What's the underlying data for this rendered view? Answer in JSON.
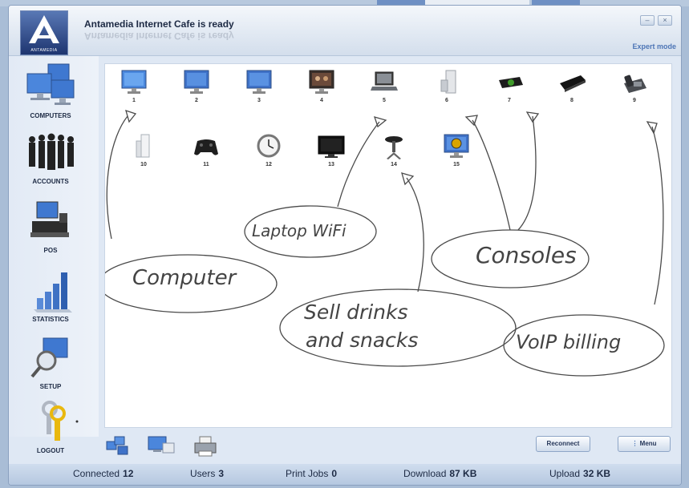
{
  "app": {
    "title": "Antamedia Internet Cafe is ready",
    "logo_text": "ANTAMEDIA",
    "mode_link": "Expert mode",
    "window_buttons": [
      "–",
      "×"
    ]
  },
  "sidebar": {
    "items": [
      {
        "label": "COMPUTERS",
        "icon": "computers-icon"
      },
      {
        "label": "ACCOUNTS",
        "icon": "accounts-icon"
      },
      {
        "label": "POS",
        "icon": "pos-icon"
      },
      {
        "label": "STATISTICS",
        "icon": "statistics-icon"
      },
      {
        "label": "SETUP",
        "icon": "setup-icon"
      },
      {
        "label": "LOGOUT",
        "icon": "logout-icon"
      }
    ]
  },
  "stations": [
    {
      "num": "1",
      "icon": "monitor-icon"
    },
    {
      "num": "2",
      "icon": "monitor-icon"
    },
    {
      "num": "3",
      "icon": "monitor-icon"
    },
    {
      "num": "4",
      "icon": "monitor-photo-icon"
    },
    {
      "num": "5",
      "icon": "laptop-icon"
    },
    {
      "num": "6",
      "icon": "xbox360-icon"
    },
    {
      "num": "7",
      "icon": "xbox-icon"
    },
    {
      "num": "8",
      "icon": "playstation-icon"
    },
    {
      "num": "9",
      "icon": "voip-phone-icon"
    },
    {
      "num": "10",
      "icon": "wii-icon"
    },
    {
      "num": "11",
      "icon": "gamepad-icon"
    },
    {
      "num": "12",
      "icon": "clock-icon"
    },
    {
      "num": "13",
      "icon": "tv-icon"
    },
    {
      "num": "14",
      "icon": "table-icon"
    },
    {
      "num": "15",
      "icon": "monitor-clock-icon"
    }
  ],
  "annotations": {
    "computer": "Computer",
    "laptop": "Laptop WiFi",
    "consoles": "Consoles",
    "drinks_line1": "Sell drinks",
    "drinks_line2": "and snacks",
    "voip": "VoIP billing"
  },
  "toolbar": {
    "icons": [
      "network-icon",
      "computer-screen-icon",
      "printer-icon"
    ],
    "reconnect_label": "Reconnect",
    "menu_label": "Menu"
  },
  "status": {
    "connected_label": "Connected",
    "connected_value": "12",
    "users_label": "Users",
    "users_value": "3",
    "print_label": "Print Jobs",
    "print_value": "0",
    "download_label": "Download",
    "download_value": "87 KB",
    "upload_label": "Upload",
    "upload_value": "32 KB"
  },
  "colors": {
    "accent": "#4e76b6",
    "title_text": "#1d2a44",
    "window_bg": "#dfe8f4",
    "status_bg": "#b3c6df"
  }
}
